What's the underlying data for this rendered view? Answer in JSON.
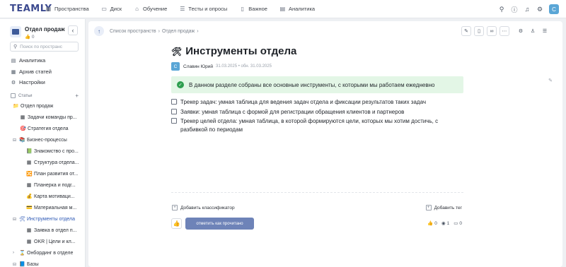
{
  "topbar": {
    "logo": "TEAMLY",
    "nav": [
      {
        "label": "Пространства",
        "icon": "grid-icon"
      },
      {
        "label": "Диск",
        "icon": "folder-icon"
      },
      {
        "label": "Обучение",
        "icon": "graduation-icon"
      },
      {
        "label": "Тесты и опросы",
        "icon": "checklist-icon"
      },
      {
        "label": "Важное",
        "icon": "bookmark-icon"
      },
      {
        "label": "Аналитика",
        "icon": "chart-icon"
      }
    ],
    "avatar": "C"
  },
  "sidebar": {
    "space_title": "Отдел продаж",
    "space_likes": "0",
    "search_placeholder": "Поиск по пространс",
    "links": [
      "Аналитика",
      "Архив статей",
      "Настройки"
    ],
    "section_label": "Статьи",
    "tree": [
      {
        "label": "Отдел продаж",
        "icon": "📁"
      },
      {
        "label": "Задачи команды пр...",
        "icon": "▦"
      },
      {
        "label": "Стратегия отдела",
        "icon": "🎯"
      },
      {
        "label": "Бизнес-процессы",
        "icon": "📚"
      },
      {
        "label": "Знакомство с про...",
        "icon": "📗"
      },
      {
        "label": "Структура отдела...",
        "icon": "▦"
      },
      {
        "label": "План развития от...",
        "icon": "🔀"
      },
      {
        "label": "Планерка и подг...",
        "icon": "▦"
      },
      {
        "label": "Карта мотиваци...",
        "icon": "💰"
      },
      {
        "label": "Материальная м...",
        "icon": "💳"
      },
      {
        "label": "Инструменты отдела",
        "icon": "🛠"
      },
      {
        "label": "Заявка в отдел п...",
        "icon": "▦"
      },
      {
        "label": "OKR | Цели и кл...",
        "icon": "▦"
      },
      {
        "label": "Онбординг в отделе",
        "icon": "⌛"
      },
      {
        "label": "Базы",
        "icon": "📘"
      }
    ]
  },
  "content": {
    "breadcrumb": [
      "Список пространств",
      "Отдел продаж"
    ],
    "title": "Инструменты отдела",
    "title_emoji": "🛠",
    "author_initial": "С",
    "author": "Славин Юрий",
    "dates": "31.03.2025 • обн. 31.03.2025",
    "callout": "В данном разделе собраны все основные инструменты, с которыми мы работаем ежедневно",
    "todos": [
      "Трекер задач: умная таблица для ведения задач отдела и фиксации результатов таких задач",
      "Заявки: умная таблица с формой для регистрации обращения клиентов и партнеров",
      "Трекер целей отдела: умная таблица, в которой формируются цели, которых мы хотим достичь, с разбивкой по периодам"
    ],
    "add_classifier": "Добавить классификатор",
    "add_tag": "Добавить тег",
    "mark_read": "отметить как прочитано",
    "likes": "0",
    "views": "1",
    "comments": "0"
  },
  "colors": {
    "accent": "#2d58b5",
    "button": "#6e83b8",
    "callout_bg": "#e3f6e6",
    "callout_icon": "#2e9e4f",
    "avatar": "#5aa6d6"
  }
}
